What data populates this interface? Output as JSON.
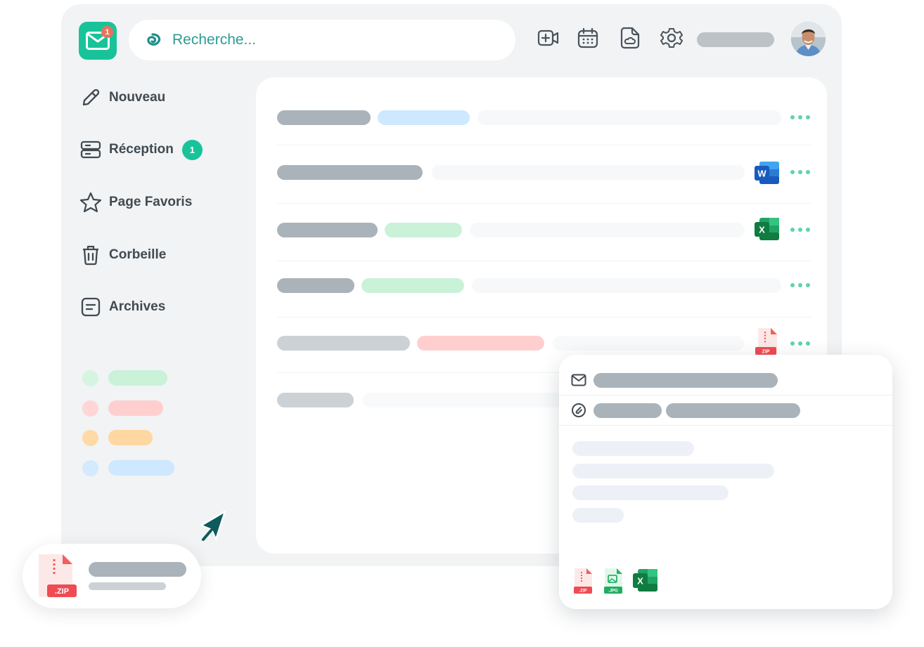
{
  "app": {
    "logo_unread_count": "1"
  },
  "search": {
    "placeholder": "Recherche..."
  },
  "toolbar": {
    "icons": [
      "video-add-icon",
      "calendar-icon",
      "drive-file-icon",
      "settings-icon"
    ]
  },
  "sidebar": {
    "items": [
      {
        "label": "Nouveau",
        "icon": "pencil-icon"
      },
      {
        "label": "Réception",
        "icon": "inbox-icon",
        "count": "1"
      },
      {
        "label": "Page Favoris",
        "icon": "star-icon"
      },
      {
        "label": "Corbeille",
        "icon": "trash-icon"
      },
      {
        "label": "Archives",
        "icon": "archive-icon"
      }
    ],
    "labels": [
      {
        "color": "#c9f2d8"
      },
      {
        "color": "#ffcfcf"
      },
      {
        "color": "#ffd7a1"
      },
      {
        "color": "#cde8ff"
      }
    ]
  },
  "mail_list": {
    "rows": [
      {
        "tag_color": "#cde8ff",
        "attachment": null
      },
      {
        "tag_color": null,
        "attachment": "word"
      },
      {
        "tag_color": "#c9f2d8",
        "attachment": "excel"
      },
      {
        "tag_color": "#c9f2d8",
        "attachment": null
      },
      {
        "tag_color": "#ffcfcf",
        "attachment": "zip"
      },
      {
        "tag_color": null,
        "attachment": null
      }
    ]
  },
  "preview": {
    "attachments": [
      {
        "type": "zip",
        "label": ".ZIP"
      },
      {
        "type": "jpg",
        "label": ".JPG"
      },
      {
        "type": "excel",
        "label": "X"
      }
    ]
  },
  "download": {
    "file_label": ".ZIP"
  },
  "attachment_badges": {
    "word": "W",
    "excel": "X",
    "zip": "ZIP"
  },
  "colors": {
    "brand": "#19c39a",
    "accent_text": "#2c9b94",
    "notification": "#e8735c"
  }
}
